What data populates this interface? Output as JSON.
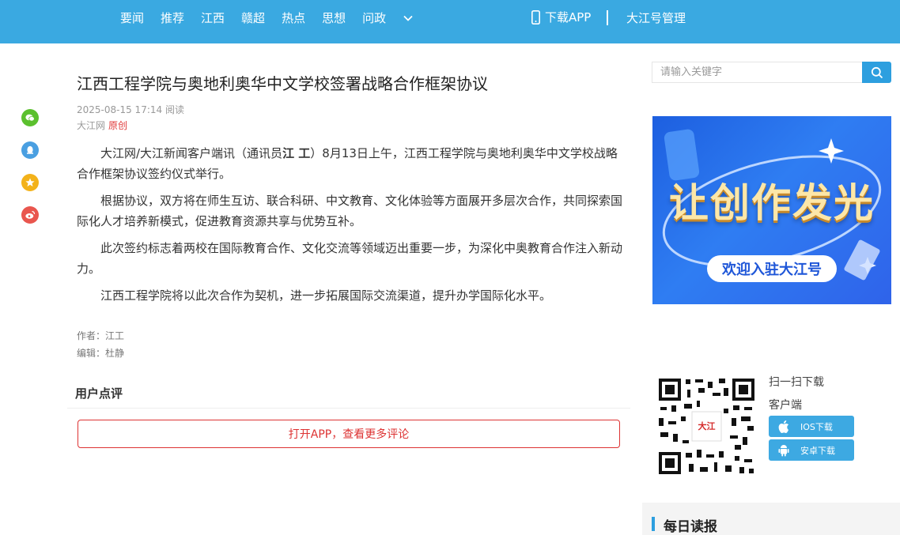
{
  "header": {
    "nav": [
      "要闻",
      "推荐",
      "江西",
      "赣超",
      "热点",
      "思想",
      "问政"
    ],
    "more_icon": "chevron-down-icon",
    "download_app": "下载APP",
    "manage": "大江号管理",
    "colors": {
      "bar": "#3aa9e1",
      "accent": "#2d9fdf"
    }
  },
  "share": [
    {
      "name": "wechat-icon",
      "color": "#5bc02e"
    },
    {
      "name": "qq-icon",
      "color": "#4a9fe1"
    },
    {
      "name": "qzone-icon",
      "color": "#f3b21a"
    },
    {
      "name": "weibo-icon",
      "color": "#e9564e"
    }
  ],
  "article": {
    "title": "江西工程学院与奥地利奥华中文学校签署战略合作框架协议",
    "date": "2025-08-15 17:14",
    "read_label": "阅读",
    "source": "大江网",
    "original": "原创",
    "p1_pre": "大江网/大江新闻客户端讯（通讯员",
    "p1_bold": "江 工",
    "p1_post": "）8月13日上午，江西工程学院与奥地利奥华中文学校战略合作框架协议签约仪式举行。",
    "p2": "根据协议，双方将在师生互访、联合科研、中文教育、文化体验等方面展开多层次合作，共同探索国际化人才培养新模式，促进教育资源共享与优势互补。",
    "p3": "此次签约标志着两校在国际教育合作、文化交流等领域迈出重要一步，为深化中奥教育合作注入新动力。",
    "p4": "江西工程学院将以此次合作为契机，进一步拓展国际交流渠道，提升办学国际化水平。",
    "author": "作者：江工",
    "editor": "编辑：杜静"
  },
  "comments": {
    "title": "用户点评",
    "open_app": "打开APP，查看更多评论"
  },
  "sidebar": {
    "search_placeholder": "请输入关键字",
    "banner_title": "让创作发光",
    "banner_sub": "欢迎入驻大江号",
    "qr_center": "大江",
    "scan": "扫一扫下载",
    "client": "客户端",
    "ios": "IOS下载",
    "android": "安卓下载",
    "daily": "每日读报"
  }
}
